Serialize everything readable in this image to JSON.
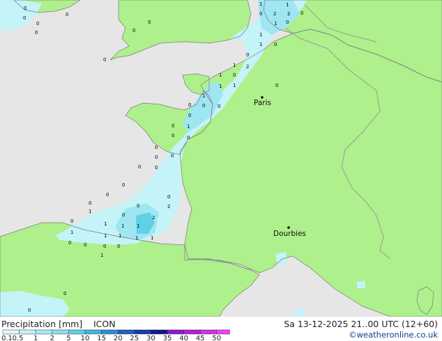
{
  "header": {
    "legend_title": "Precipitation [mm]",
    "model": "ICON",
    "datetime": "Sa 13-12-2025 21..00 UTC (12+60)",
    "credit": "©weatheronline.co.uk"
  },
  "cities": [
    {
      "name": "Paris"
    },
    {
      "name": "Dourbies"
    }
  ],
  "colors": {
    "sea": "#e6e6e6",
    "land": "#aef08c",
    "border": "#9a9a9a",
    "coast": "#7a7a7a",
    "rain_light": "#c4f3f8",
    "rain_mid": "#9de6f2",
    "rain_heavy": "#5fd0e6"
  },
  "legend_scale": {
    "ticks": [
      "0.1",
      "0.5",
      "1",
      "2",
      "5",
      "10",
      "15",
      "20",
      "25",
      "30",
      "35",
      "40",
      "45",
      "50"
    ],
    "colors": [
      "#e0f8fb",
      "#c4f3f8",
      "#a7eaf4",
      "#88dff0",
      "#5fd0e6",
      "#3db8de",
      "#2e8fd0",
      "#2160bf",
      "#163aa8",
      "#0e1a8c",
      "#8a1ad6",
      "#b41fe0",
      "#d62fe8",
      "#f23ff0"
    ]
  },
  "precip_values": [
    "0",
    "0",
    "0",
    "0",
    "0",
    "0",
    "0",
    "0",
    "1",
    "1",
    "0",
    "2",
    "2",
    "0",
    "1",
    "0",
    "1",
    "1",
    "0",
    "0",
    "2",
    "1",
    "0",
    "1",
    "1",
    "1",
    "1",
    "0",
    "0",
    "0",
    "0",
    "0",
    "1",
    "0",
    "0",
    "0",
    "0",
    "0",
    "0",
    "0",
    "0",
    "0",
    "0",
    "0",
    "1",
    "0",
    "2",
    "0",
    "0",
    "1",
    "1",
    "2",
    "0",
    "1",
    "1",
    "1",
    "1",
    "1",
    "1",
    "0",
    "0",
    "0",
    "0",
    "1",
    "0",
    "0"
  ]
}
